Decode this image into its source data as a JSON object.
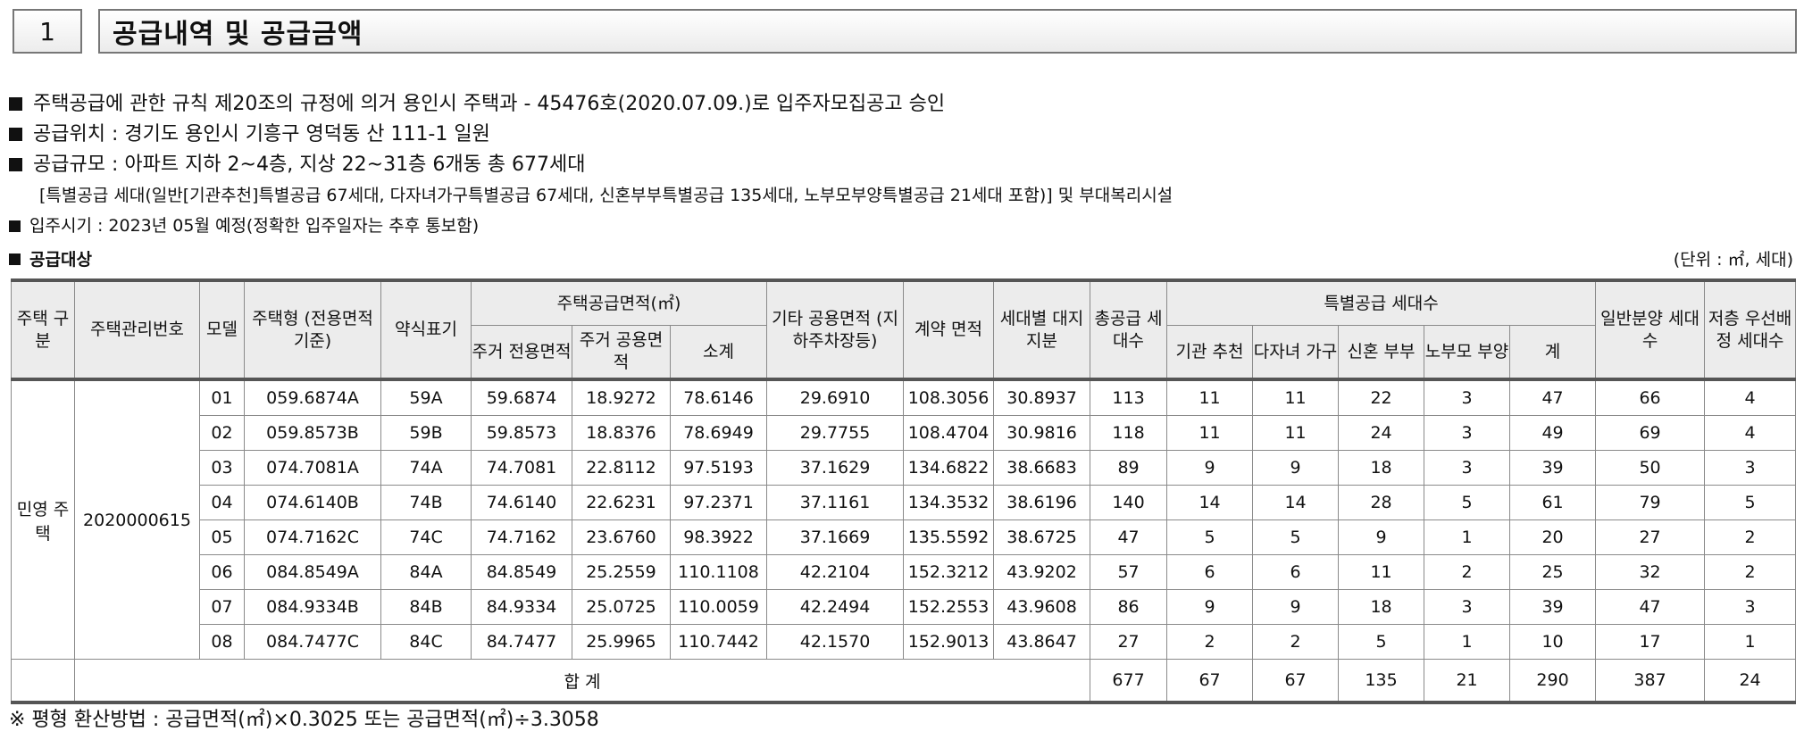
{
  "section": {
    "number": "1",
    "title": "공급내역 및 공급금액"
  },
  "bullets": [
    "주택공급에 관한 규칙 제20조의 규정에 의거 용인시 주택과 - 45476호(2020.07.09.)로 입주자모집공고 승인",
    "공급위치 : 경기도 용인시 기흥구 영덕동 산 111-1 일원",
    "공급규모 : 아파트 지하 2~4층, 지상 22~31층 6개동 총 677세대"
  ],
  "bullet_sub": "[특별공급 세대(일반[기관추천]특별공급 67세대, 다자녀가구특별공급 67세대, 신혼부부특별공급 135세대, 노부모부양특별공급 21세대 포함)] 및 부대복리시설",
  "move_in": "입주시기 : 2023년 05월 예정(정확한 입주일자는 추후 통보함)",
  "table_title": "공급대상",
  "unit_note": "(단위 : ㎡, 세대)",
  "headers": {
    "type": "주택 구분",
    "mgmt_no": "주택관리번호",
    "model": "모델",
    "housing_type": "주택형 (전용면적기준)",
    "short": "약식표기",
    "supply_area": "주택공급면적(㎡)",
    "exclusive": "주거 전용면적",
    "common": "주거 공용면적",
    "subtotal": "소계",
    "other_common": "기타 공용면적 (지하주차장등)",
    "contract": "계약 면적",
    "land": "세대별 대지지분",
    "total_supply": "총공급 세대수",
    "special": "특별공급 세대수",
    "institution": "기관 추천",
    "multi_child": "다자녀 가구",
    "newlywed": "신혼 부부",
    "elderly": "노부모 부양",
    "special_total": "계",
    "general": "일반분양 세대수",
    "low_floor": "저층 우선배정 세대수"
  },
  "housing_category": "민영 주택",
  "mgmt_number": "2020000615",
  "rows": [
    [
      "01",
      "059.6874A",
      "59A",
      "59.6874",
      "18.9272",
      "78.6146",
      "29.6910",
      "108.3056",
      "30.8937",
      "113",
      "11",
      "11",
      "22",
      "3",
      "47",
      "66",
      "4"
    ],
    [
      "02",
      "059.8573B",
      "59B",
      "59.8573",
      "18.8376",
      "78.6949",
      "29.7755",
      "108.4704",
      "30.9816",
      "118",
      "11",
      "11",
      "24",
      "3",
      "49",
      "69",
      "4"
    ],
    [
      "03",
      "074.7081A",
      "74A",
      "74.7081",
      "22.8112",
      "97.5193",
      "37.1629",
      "134.6822",
      "38.6683",
      "89",
      "9",
      "9",
      "18",
      "3",
      "39",
      "50",
      "3"
    ],
    [
      "04",
      "074.6140B",
      "74B",
      "74.6140",
      "22.6231",
      "97.2371",
      "37.1161",
      "134.3532",
      "38.6196",
      "140",
      "14",
      "14",
      "28",
      "5",
      "61",
      "79",
      "5"
    ],
    [
      "05",
      "074.7162C",
      "74C",
      "74.7162",
      "23.6760",
      "98.3922",
      "37.1669",
      "135.5592",
      "38.6725",
      "47",
      "5",
      "5",
      "9",
      "1",
      "20",
      "27",
      "2"
    ],
    [
      "06",
      "084.8549A",
      "84A",
      "84.8549",
      "25.2559",
      "110.1108",
      "42.2104",
      "152.3212",
      "43.9202",
      "57",
      "6",
      "6",
      "11",
      "2",
      "25",
      "32",
      "2"
    ],
    [
      "07",
      "084.9334B",
      "84B",
      "84.9334",
      "25.0725",
      "110.0059",
      "42.2494",
      "152.2553",
      "43.9608",
      "86",
      "9",
      "9",
      "18",
      "3",
      "39",
      "47",
      "3"
    ],
    [
      "08",
      "084.7477C",
      "84C",
      "84.7477",
      "25.9965",
      "110.7442",
      "42.1570",
      "152.9013",
      "43.8647",
      "27",
      "2",
      "2",
      "5",
      "1",
      "10",
      "17",
      "1"
    ]
  ],
  "total": {
    "label": "합 계",
    "values": [
      "677",
      "67",
      "67",
      "135",
      "21",
      "290",
      "387",
      "24"
    ]
  },
  "footnote": "※ 평형 환산방법 : 공급면적(㎡)×0.3025 또는 공급면적(㎡)÷3.3058"
}
